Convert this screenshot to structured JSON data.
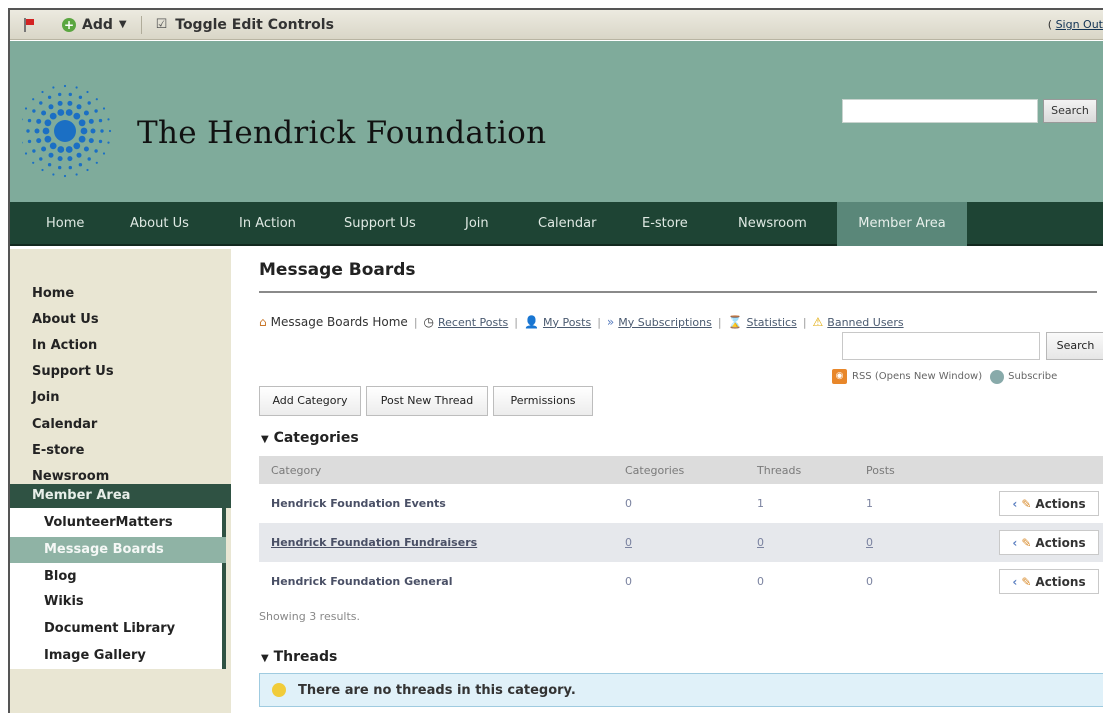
{
  "dockbar": {
    "add_label": "Add",
    "add_caret": "▼",
    "toggle_label": "Toggle Edit Controls",
    "signout_prefix": "(",
    "signout_label": "Sign Out"
  },
  "header": {
    "site_title": "The Hendrick Foundation",
    "search_button": "Search",
    "search_value": ""
  },
  "nav": [
    {
      "label": "Home"
    },
    {
      "label": "About Us"
    },
    {
      "label": "In Action"
    },
    {
      "label": "Support Us"
    },
    {
      "label": "Join"
    },
    {
      "label": "Calendar"
    },
    {
      "label": "E-store"
    },
    {
      "label": "Newsroom"
    },
    {
      "label": "Member Area",
      "active": true
    }
  ],
  "sidebar": {
    "items": [
      {
        "label": "Home"
      },
      {
        "label": "About Us"
      },
      {
        "label": "In Action"
      },
      {
        "label": "Support Us"
      },
      {
        "label": "Join"
      },
      {
        "label": "Calendar"
      },
      {
        "label": "E-store"
      },
      {
        "label": "Newsroom"
      }
    ],
    "member_area": "Member Area",
    "sub_items": [
      {
        "label": "VolunteerMatters"
      },
      {
        "label": "Message Boards",
        "active": true
      },
      {
        "label": "Blog"
      },
      {
        "label": "Wikis"
      },
      {
        "label": "Document Library"
      },
      {
        "label": "Image Gallery"
      }
    ]
  },
  "main": {
    "title": "Message Boards",
    "toolbar": {
      "home": "Message Boards Home",
      "recent": "Recent Posts",
      "my_posts": "My Posts",
      "subscriptions": "My Subscriptions",
      "statistics": "Statistics",
      "banned": "Banned Users"
    },
    "search_button": "Search",
    "search_value": "",
    "rss_label": "RSS (Opens New Window)",
    "subscribe_label": "Subscribe",
    "buttons": {
      "add_category": "Add Category",
      "post_thread": "Post New Thread",
      "permissions": "Permissions"
    },
    "categories_heading": "Categories",
    "table": {
      "headers": [
        "Category",
        "Categories",
        "Threads",
        "Posts"
      ],
      "rows": [
        {
          "name": "Hendrick Foundation Events",
          "categories": "0",
          "threads": "1",
          "posts": "1",
          "actions": "Actions"
        },
        {
          "name": "Hendrick Foundation Fundraisers",
          "categories": "0",
          "threads": "0",
          "posts": "0",
          "actions": "Actions"
        },
        {
          "name": "Hendrick Foundation General",
          "categories": "0",
          "threads": "0",
          "posts": "0",
          "actions": "Actions"
        }
      ]
    },
    "showing": "Showing 3 results.",
    "threads_heading": "Threads",
    "no_threads": "There are no threads in this category."
  },
  "colors": {
    "header_bg": "#7fab9b",
    "nav_bg": "#1e4434",
    "nav_active": "#5a8779",
    "sidebar_bg": "#e9e6d3",
    "member_area_bg": "#2f5243",
    "active_sub_bg": "#8fb3a5",
    "info_bg": "#e0f1f9",
    "logo_blue": "#1b6fc4"
  }
}
